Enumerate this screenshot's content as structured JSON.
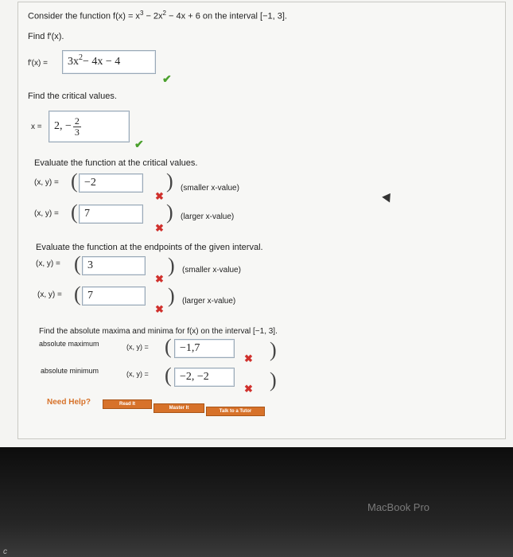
{
  "question": {
    "prefix": "Consider the function f(x) = x",
    "exp1": "3",
    "mid1": " − 2x",
    "exp2": "2",
    "mid2": " − 4x + 6 on the interval [−1, 3]."
  },
  "derivative": {
    "prompt": "Find f′(x).",
    "label": "f′(x) =",
    "answer_base": "3x",
    "answer_exp": "2",
    "answer_rest": " − 4x − 4"
  },
  "critical": {
    "prompt": "Find the critical values.",
    "label": "x =",
    "answer_lead": "2, −",
    "answer_num": "2",
    "answer_den": "3"
  },
  "evaluate_critical": {
    "prompt": "Evaluate the function at the critical values.",
    "rows": [
      {
        "label": "(x, y) =",
        "value": "−2",
        "note": "(smaller x-value)"
      },
      {
        "label": "(x, y) =",
        "value": "7",
        "note": "(larger x-value)"
      }
    ]
  },
  "evaluate_endpoints": {
    "prompt": "Evaluate the function at the endpoints of the given interval.",
    "rows": [
      {
        "label": "(x, y) =",
        "value": "3",
        "note": "(smaller x-value)"
      },
      {
        "label": "(x, y) =",
        "value": "7",
        "note": "(larger x-value)"
      }
    ]
  },
  "extrema": {
    "prompt": "Find the absolute maxima and minima for f(x) on the interval [−1, 3].",
    "max_label": "absolute maximum",
    "min_label": "absolute minimum",
    "xy_label": "(x, y) =",
    "max_value": "−1,7",
    "min_value": "−2, −2"
  },
  "help": {
    "label": "Need Help?",
    "buttons": [
      "Read It",
      "Master It",
      "Talk to a Tutor"
    ]
  },
  "marks": {
    "check": "✔",
    "cross": "✖"
  },
  "laptop": {
    "brand": "MacBook Pro",
    "key_c": "c"
  },
  "colors": {
    "check": "#4aa02c",
    "cross": "#d0312d",
    "accent": "#d7722a"
  }
}
